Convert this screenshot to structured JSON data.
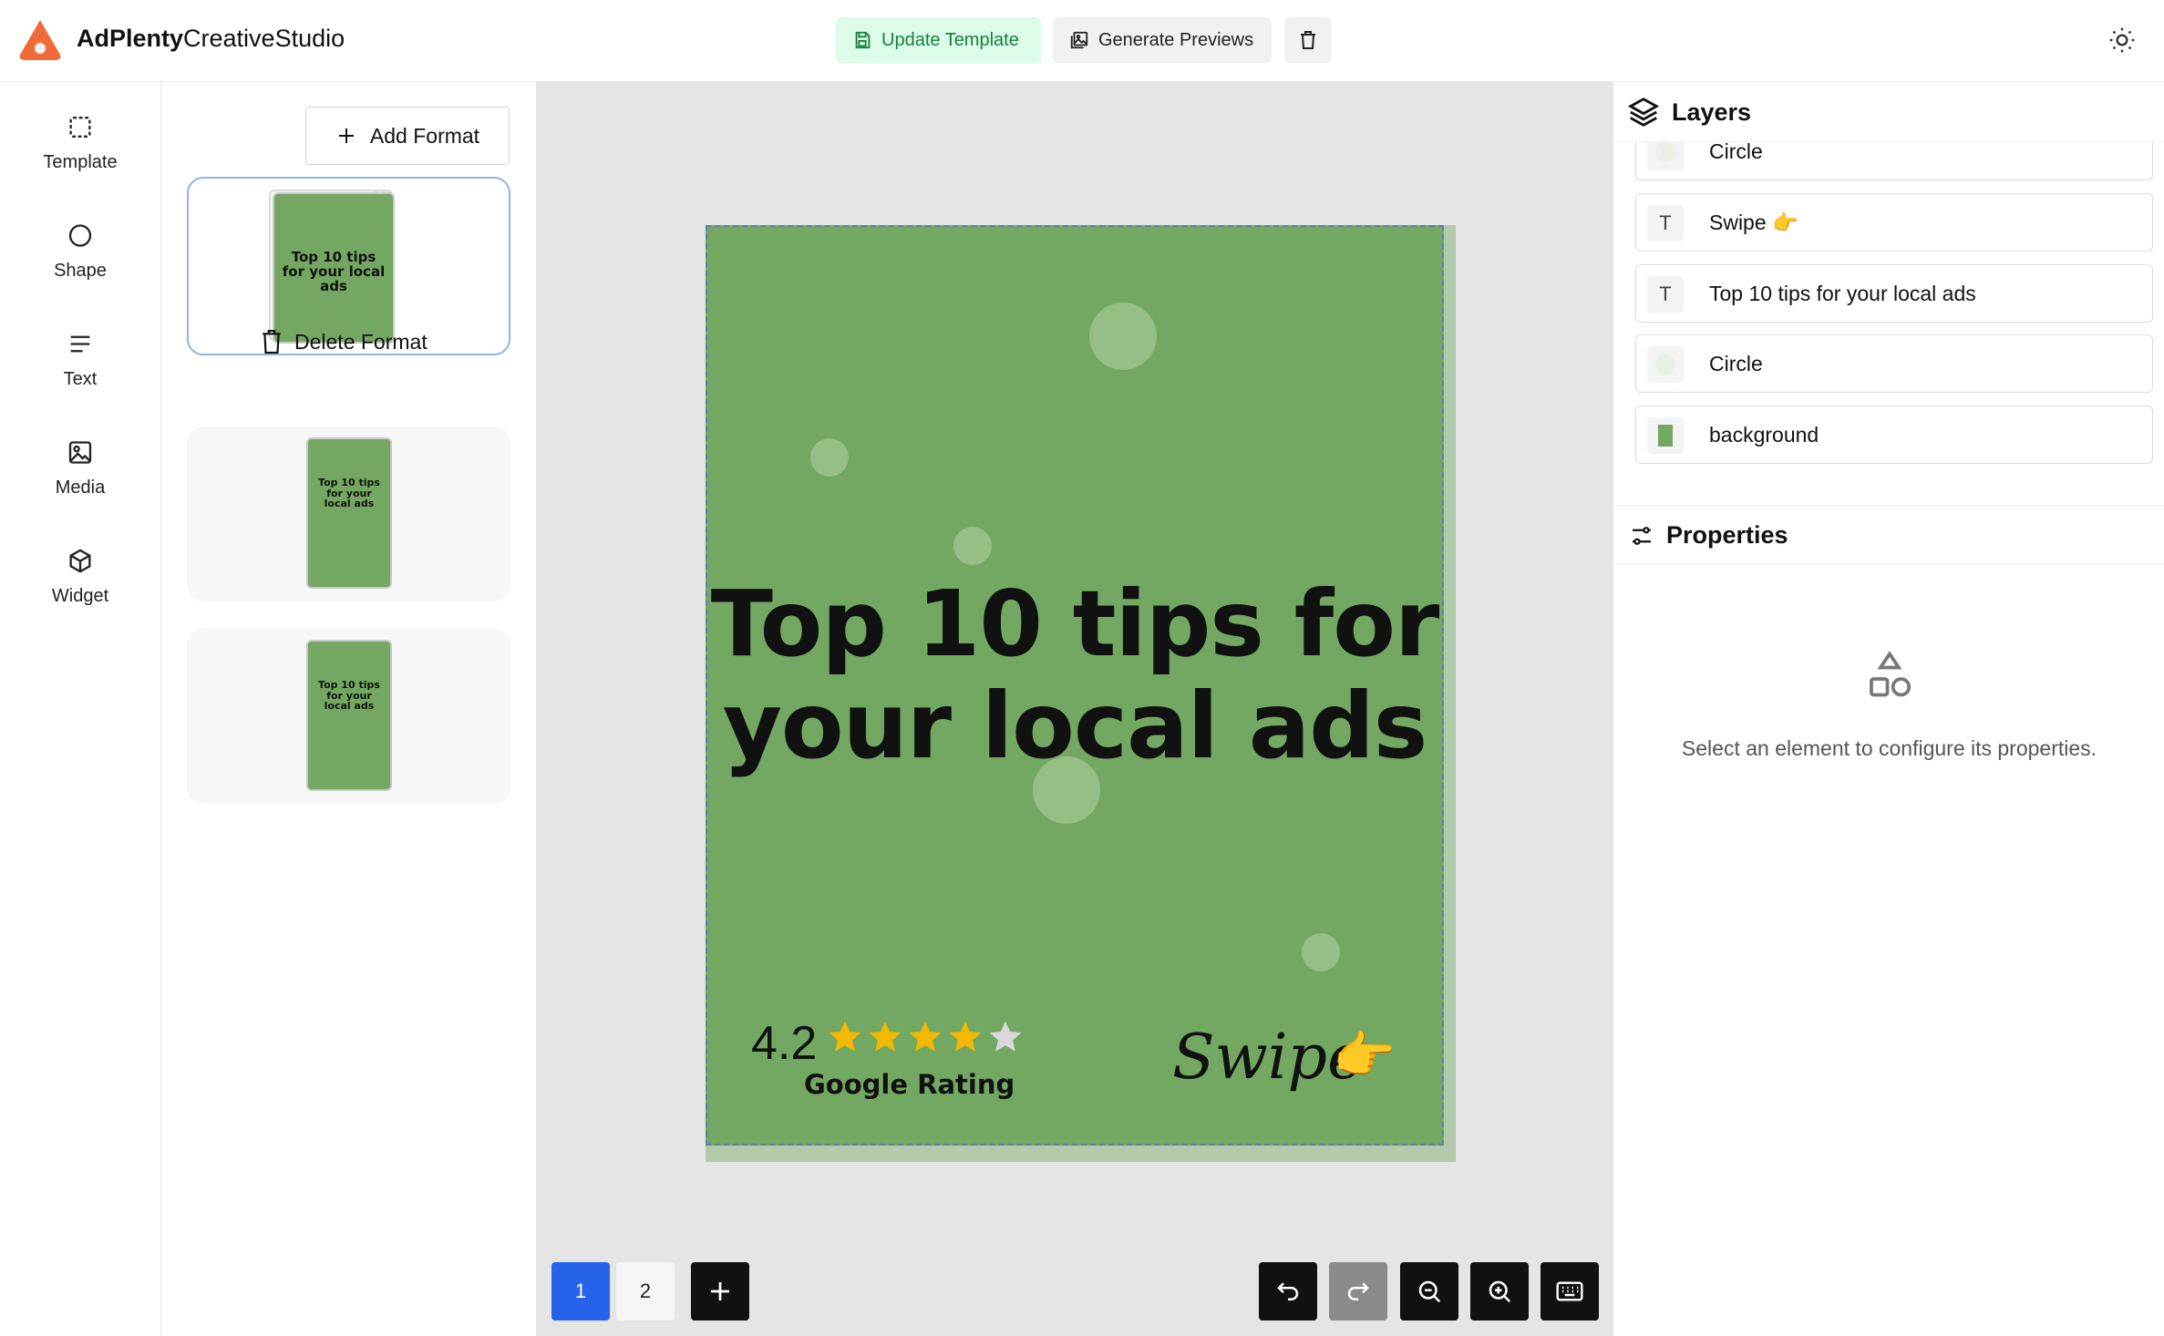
{
  "app": {
    "brand_bold": "AdPlenty",
    "brand_rest": "CreativeStudio"
  },
  "header": {
    "update_label": "Update Template",
    "generate_label": "Generate Previews"
  },
  "nav": {
    "items": [
      {
        "label": "Template",
        "icon": "template-icon"
      },
      {
        "label": "Shape",
        "icon": "shape-icon"
      },
      {
        "label": "Text",
        "icon": "text-icon"
      },
      {
        "label": "Media",
        "icon": "media-icon"
      },
      {
        "label": "Widget",
        "icon": "widget-icon"
      }
    ]
  },
  "formats": {
    "add_label": "Add Format",
    "delete_label": "Delete Format",
    "thumb_title": "Top 10 tips for your local ads"
  },
  "canvas": {
    "headline_1": "Top 10 tips for",
    "headline_2": "your local ads",
    "rating_value": "4.2",
    "rating_stars": 4,
    "rating_max": 5,
    "rating_label": "Google Rating",
    "swipe_text": "Swipe",
    "swipe_emoji": "👉",
    "background_color": "#73a862"
  },
  "pages": {
    "p1": "1",
    "p2": "2",
    "current": 1
  },
  "layers": {
    "title": "Layers",
    "items": [
      {
        "name": "Circle",
        "type": "shape"
      },
      {
        "name": "Swipe 👉",
        "type": "text"
      },
      {
        "name": "Top 10 tips for your local ads",
        "type": "text"
      },
      {
        "name": "Circle",
        "type": "shape"
      },
      {
        "name": "background",
        "type": "rect"
      }
    ]
  },
  "properties": {
    "title": "Properties",
    "empty_text": "Select an element to configure its properties."
  },
  "colors": {
    "accent": "#2563eb",
    "success_bg": "#dcfce7",
    "success_fg": "#15803d",
    "brand": "#f06a3a"
  }
}
